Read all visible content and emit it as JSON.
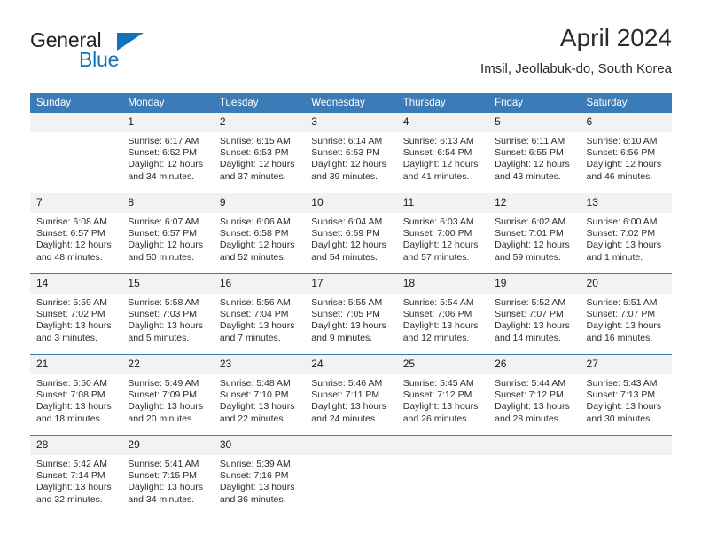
{
  "brand": {
    "name_part1": "General",
    "name_part2": "Blue",
    "logo_icon": "triangle-flag-icon"
  },
  "header": {
    "month_title": "April 2024",
    "location": "Imsil, Jeollabuk-do, South Korea"
  },
  "calendar": {
    "accent_color": "#3b7cb8",
    "daynum_bg": "#f2f2f2",
    "weekday_headers": [
      "Sunday",
      "Monday",
      "Tuesday",
      "Wednesday",
      "Thursday",
      "Friday",
      "Saturday"
    ],
    "weeks": [
      [
        {
          "day": "",
          "sunrise": "",
          "sunset": "",
          "daylight_line1": "",
          "daylight_line2": ""
        },
        {
          "day": "1",
          "sunrise": "Sunrise: 6:17 AM",
          "sunset": "Sunset: 6:52 PM",
          "daylight_line1": "Daylight: 12 hours",
          "daylight_line2": "and 34 minutes."
        },
        {
          "day": "2",
          "sunrise": "Sunrise: 6:15 AM",
          "sunset": "Sunset: 6:53 PM",
          "daylight_line1": "Daylight: 12 hours",
          "daylight_line2": "and 37 minutes."
        },
        {
          "day": "3",
          "sunrise": "Sunrise: 6:14 AM",
          "sunset": "Sunset: 6:53 PM",
          "daylight_line1": "Daylight: 12 hours",
          "daylight_line2": "and 39 minutes."
        },
        {
          "day": "4",
          "sunrise": "Sunrise: 6:13 AM",
          "sunset": "Sunset: 6:54 PM",
          "daylight_line1": "Daylight: 12 hours",
          "daylight_line2": "and 41 minutes."
        },
        {
          "day": "5",
          "sunrise": "Sunrise: 6:11 AM",
          "sunset": "Sunset: 6:55 PM",
          "daylight_line1": "Daylight: 12 hours",
          "daylight_line2": "and 43 minutes."
        },
        {
          "day": "6",
          "sunrise": "Sunrise: 6:10 AM",
          "sunset": "Sunset: 6:56 PM",
          "daylight_line1": "Daylight: 12 hours",
          "daylight_line2": "and 46 minutes."
        }
      ],
      [
        {
          "day": "7",
          "sunrise": "Sunrise: 6:08 AM",
          "sunset": "Sunset: 6:57 PM",
          "daylight_line1": "Daylight: 12 hours",
          "daylight_line2": "and 48 minutes."
        },
        {
          "day": "8",
          "sunrise": "Sunrise: 6:07 AM",
          "sunset": "Sunset: 6:57 PM",
          "daylight_line1": "Daylight: 12 hours",
          "daylight_line2": "and 50 minutes."
        },
        {
          "day": "9",
          "sunrise": "Sunrise: 6:06 AM",
          "sunset": "Sunset: 6:58 PM",
          "daylight_line1": "Daylight: 12 hours",
          "daylight_line2": "and 52 minutes."
        },
        {
          "day": "10",
          "sunrise": "Sunrise: 6:04 AM",
          "sunset": "Sunset: 6:59 PM",
          "daylight_line1": "Daylight: 12 hours",
          "daylight_line2": "and 54 minutes."
        },
        {
          "day": "11",
          "sunrise": "Sunrise: 6:03 AM",
          "sunset": "Sunset: 7:00 PM",
          "daylight_line1": "Daylight: 12 hours",
          "daylight_line2": "and 57 minutes."
        },
        {
          "day": "12",
          "sunrise": "Sunrise: 6:02 AM",
          "sunset": "Sunset: 7:01 PM",
          "daylight_line1": "Daylight: 12 hours",
          "daylight_line2": "and 59 minutes."
        },
        {
          "day": "13",
          "sunrise": "Sunrise: 6:00 AM",
          "sunset": "Sunset: 7:02 PM",
          "daylight_line1": "Daylight: 13 hours",
          "daylight_line2": "and 1 minute."
        }
      ],
      [
        {
          "day": "14",
          "sunrise": "Sunrise: 5:59 AM",
          "sunset": "Sunset: 7:02 PM",
          "daylight_line1": "Daylight: 13 hours",
          "daylight_line2": "and 3 minutes."
        },
        {
          "day": "15",
          "sunrise": "Sunrise: 5:58 AM",
          "sunset": "Sunset: 7:03 PM",
          "daylight_line1": "Daylight: 13 hours",
          "daylight_line2": "and 5 minutes."
        },
        {
          "day": "16",
          "sunrise": "Sunrise: 5:56 AM",
          "sunset": "Sunset: 7:04 PM",
          "daylight_line1": "Daylight: 13 hours",
          "daylight_line2": "and 7 minutes."
        },
        {
          "day": "17",
          "sunrise": "Sunrise: 5:55 AM",
          "sunset": "Sunset: 7:05 PM",
          "daylight_line1": "Daylight: 13 hours",
          "daylight_line2": "and 9 minutes."
        },
        {
          "day": "18",
          "sunrise": "Sunrise: 5:54 AM",
          "sunset": "Sunset: 7:06 PM",
          "daylight_line1": "Daylight: 13 hours",
          "daylight_line2": "and 12 minutes."
        },
        {
          "day": "19",
          "sunrise": "Sunrise: 5:52 AM",
          "sunset": "Sunset: 7:07 PM",
          "daylight_line1": "Daylight: 13 hours",
          "daylight_line2": "and 14 minutes."
        },
        {
          "day": "20",
          "sunrise": "Sunrise: 5:51 AM",
          "sunset": "Sunset: 7:07 PM",
          "daylight_line1": "Daylight: 13 hours",
          "daylight_line2": "and 16 minutes."
        }
      ],
      [
        {
          "day": "21",
          "sunrise": "Sunrise: 5:50 AM",
          "sunset": "Sunset: 7:08 PM",
          "daylight_line1": "Daylight: 13 hours",
          "daylight_line2": "and 18 minutes."
        },
        {
          "day": "22",
          "sunrise": "Sunrise: 5:49 AM",
          "sunset": "Sunset: 7:09 PM",
          "daylight_line1": "Daylight: 13 hours",
          "daylight_line2": "and 20 minutes."
        },
        {
          "day": "23",
          "sunrise": "Sunrise: 5:48 AM",
          "sunset": "Sunset: 7:10 PM",
          "daylight_line1": "Daylight: 13 hours",
          "daylight_line2": "and 22 minutes."
        },
        {
          "day": "24",
          "sunrise": "Sunrise: 5:46 AM",
          "sunset": "Sunset: 7:11 PM",
          "daylight_line1": "Daylight: 13 hours",
          "daylight_line2": "and 24 minutes."
        },
        {
          "day": "25",
          "sunrise": "Sunrise: 5:45 AM",
          "sunset": "Sunset: 7:12 PM",
          "daylight_line1": "Daylight: 13 hours",
          "daylight_line2": "and 26 minutes."
        },
        {
          "day": "26",
          "sunrise": "Sunrise: 5:44 AM",
          "sunset": "Sunset: 7:12 PM",
          "daylight_line1": "Daylight: 13 hours",
          "daylight_line2": "and 28 minutes."
        },
        {
          "day": "27",
          "sunrise": "Sunrise: 5:43 AM",
          "sunset": "Sunset: 7:13 PM",
          "daylight_line1": "Daylight: 13 hours",
          "daylight_line2": "and 30 minutes."
        }
      ],
      [
        {
          "day": "28",
          "sunrise": "Sunrise: 5:42 AM",
          "sunset": "Sunset: 7:14 PM",
          "daylight_line1": "Daylight: 13 hours",
          "daylight_line2": "and 32 minutes."
        },
        {
          "day": "29",
          "sunrise": "Sunrise: 5:41 AM",
          "sunset": "Sunset: 7:15 PM",
          "daylight_line1": "Daylight: 13 hours",
          "daylight_line2": "and 34 minutes."
        },
        {
          "day": "30",
          "sunrise": "Sunrise: 5:39 AM",
          "sunset": "Sunset: 7:16 PM",
          "daylight_line1": "Daylight: 13 hours",
          "daylight_line2": "and 36 minutes."
        },
        {
          "day": "",
          "sunrise": "",
          "sunset": "",
          "daylight_line1": "",
          "daylight_line2": ""
        },
        {
          "day": "",
          "sunrise": "",
          "sunset": "",
          "daylight_line1": "",
          "daylight_line2": ""
        },
        {
          "day": "",
          "sunrise": "",
          "sunset": "",
          "daylight_line1": "",
          "daylight_line2": ""
        },
        {
          "day": "",
          "sunrise": "",
          "sunset": "",
          "daylight_line1": "",
          "daylight_line2": ""
        }
      ]
    ]
  }
}
